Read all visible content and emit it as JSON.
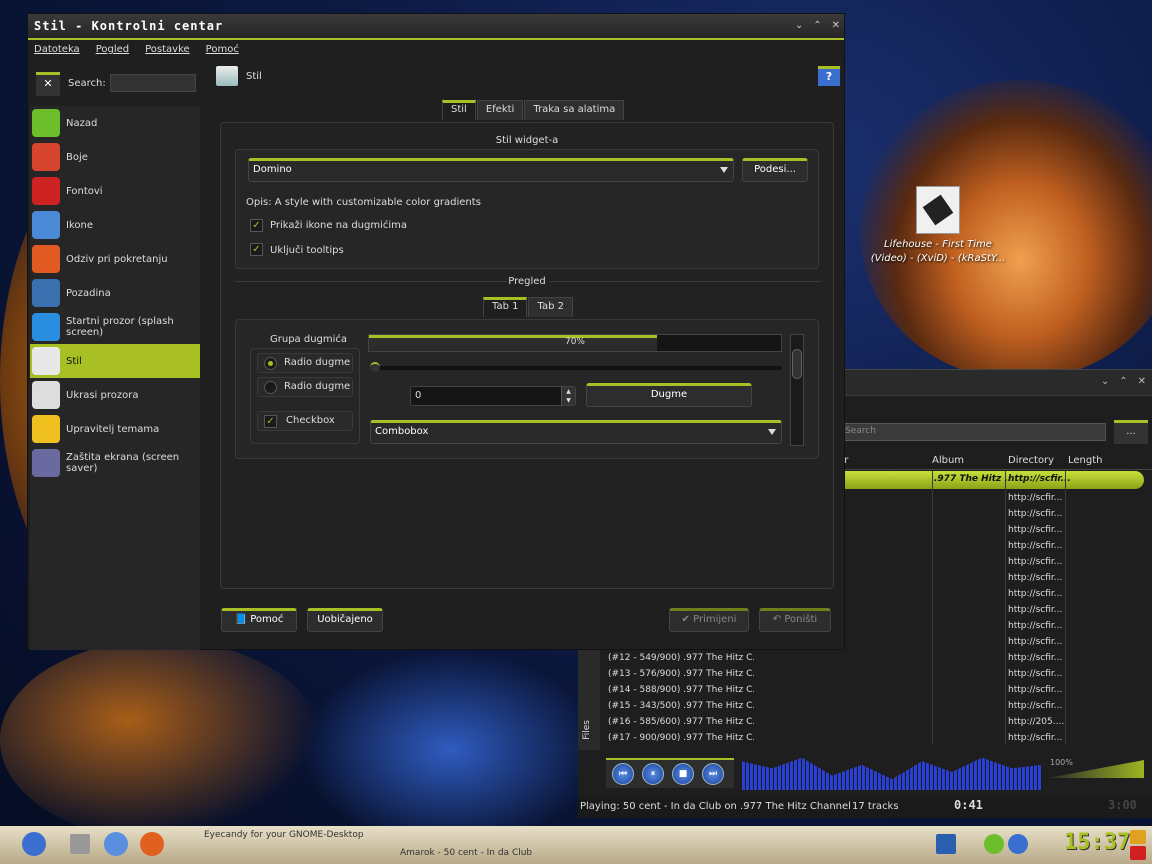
{
  "desktop": {
    "icon_label": "Lifehouse - First Time (Video) - (XviD) - (kRaStY..."
  },
  "kcontrol": {
    "title": "Stil - Kontrolni centar",
    "menu": [
      "Datoteka",
      "Pogled",
      "Postavke",
      "Pomoć"
    ],
    "search_label": "Search:",
    "sidebar": [
      {
        "label": "Nazad",
        "icon": "back-arrow-icon",
        "color": "#6cbf2a"
      },
      {
        "label": "Boje",
        "icon": "colors-icon",
        "color": "#d8452e"
      },
      {
        "label": "Fontovi",
        "icon": "fonts-icon",
        "color": "#c22"
      },
      {
        "label": "Ikone",
        "icon": "icons-icon",
        "color": "#4a8ad6"
      },
      {
        "label": "Odziv pri pokretanju",
        "icon": "rocket-icon",
        "color": "#e05a22"
      },
      {
        "label": "Pozadina",
        "icon": "background-icon",
        "color": "#3a6fb0"
      },
      {
        "label": "Startni prozor (splash screen)",
        "icon": "splash-icon",
        "color": "#2a8ee0"
      },
      {
        "label": "Stil",
        "icon": "style-icon",
        "color": "#e8e8e8",
        "active": true
      },
      {
        "label": "Ukrasi prozora",
        "icon": "window-decor-icon",
        "color": "#ddd"
      },
      {
        "label": "Upravitelj temama",
        "icon": "theme-manager-icon",
        "color": "#f0c020"
      },
      {
        "label": "Zaštita ekrana (screen saver)",
        "icon": "screensaver-icon",
        "color": "#6a6aa0"
      }
    ],
    "header_title": "Stil",
    "tabs": [
      "Stil",
      "Efekti",
      "Traka sa alatima"
    ],
    "widget_style_title": "Stil widget-a",
    "style_value": "Domino",
    "configure_button": "Podesi...",
    "description": "Opis: A style with customizable color gradients",
    "checkbox_icons": "Prikaži ikone na dugmićima",
    "checkbox_tooltips": "Uključi tooltips",
    "preview_title": "Pregled",
    "preview_tabs": [
      "Tab 1",
      "Tab 2"
    ],
    "button_group_title": "Grupa dugmića",
    "radio1": "Radio dugme",
    "radio2": "Radio dugme",
    "checkbox": "Checkbox",
    "progress_label": "70%",
    "progress_value": 70,
    "spin_value": "0",
    "push_button": "Dugme",
    "combobox": "Combobox",
    "footer": {
      "help": "Pomoć",
      "defaults": "Uobičajeno",
      "apply": "Primijeni",
      "reset": "Poništi"
    }
  },
  "amarok": {
    "search_placeholder": "Search",
    "search_btn": "...",
    "headers": [
      "ear",
      "Album",
      "Directory",
      "Length"
    ],
    "playing_row_album": ".977 The Hitz ...",
    "playing_row_dir": "http://scfir...",
    "directories": [
      "http://scfir...",
      "http://scfir...",
      "http://scfir...",
      "http://scfir...",
      "http://scfir...",
      "http://scfir...",
      "http://scfir...",
      "http://scfir...",
      "http://scfir...",
      "http://scfir...",
      "http://scfir...",
      "http://scfir...",
      "http://scfir...",
      "http://scfir...",
      "http://205....",
      "http://scfir..."
    ],
    "tracks": [
      "(#12 - 549/900) .977 The Hitz C...",
      "(#13 - 576/900) .977 The Hitz C...",
      "(#14 - 588/900) .977 The Hitz C...",
      "(#15 - 343/500) .977 The Hitz C...",
      "(#16 - 585/600) .977 The Hitz C...",
      "(#17 - 900/900) .977 The Hitz C..."
    ],
    "side_tabs": [
      "Pl",
      "Files"
    ],
    "volume": "100%",
    "status": "Playing: 50 cent - In da Club on .977 The Hitz Channel",
    "track_count": "17 tracks",
    "time": "0:41",
    "time_remaining": "3:00"
  },
  "taskbar": {
    "task1": "Eyecandy for your GNOME-Desktop",
    "task2": "Amarok - 50 cent - In da Club",
    "clock": "15:37"
  }
}
